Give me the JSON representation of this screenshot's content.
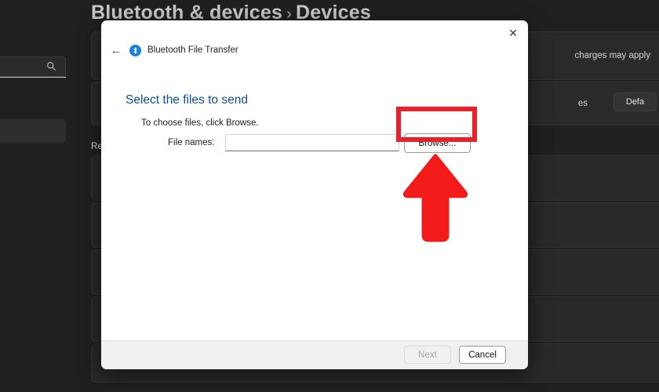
{
  "background": {
    "breadcrumb": {
      "root": "Bluetooth & devices",
      "separator": "›",
      "current": "Devices"
    },
    "search": {
      "placeholder": "",
      "icon": "search-icon"
    },
    "cards": [
      {
        "text": "charges may apply"
      },
      {
        "text": "es",
        "button_label": "Defa"
      }
    ],
    "section_label": "Re"
  },
  "dialog": {
    "close_icon": "✕",
    "back_icon": "←",
    "app_icon": "bluetooth-icon",
    "title": "Bluetooth File Transfer",
    "heading": "Select the files to send",
    "instruction": "To choose files, click Browse.",
    "field": {
      "label": "File names:",
      "value": "",
      "placeholder": ""
    },
    "browse_label": "Browse...",
    "footer": {
      "next_label": "Next",
      "cancel_label": "Cancel"
    }
  },
  "annotations": {
    "highlight_color": "#e8202a",
    "arrow_color": "#f31a1a",
    "arrow_direction": "up",
    "highlight_target": "browse-button"
  }
}
